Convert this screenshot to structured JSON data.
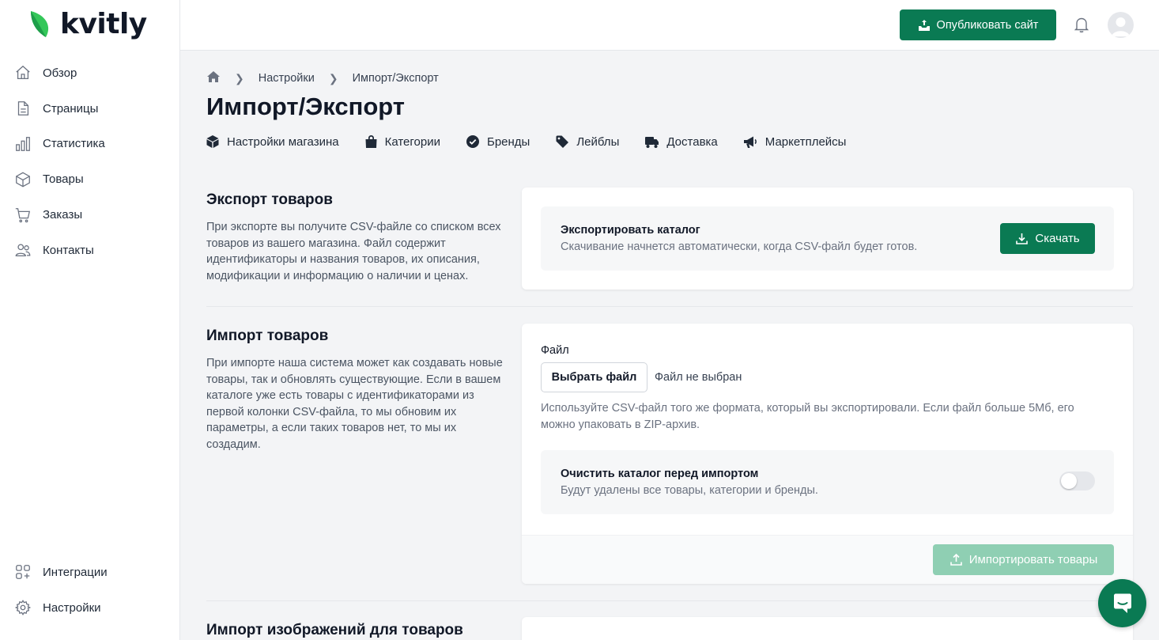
{
  "app": {
    "logo_text": "kvitly",
    "brand_color": "#0a7a53"
  },
  "sidebar": {
    "items": [
      {
        "label": "Обзор",
        "icon": "home-icon"
      },
      {
        "label": "Страницы",
        "icon": "document-icon"
      },
      {
        "label": "Статистика",
        "icon": "bar-chart-icon"
      },
      {
        "label": "Товары",
        "icon": "box-icon"
      },
      {
        "label": "Заказы",
        "icon": "cart-icon"
      },
      {
        "label": "Контакты",
        "icon": "users-icon"
      }
    ],
    "bottom_items": [
      {
        "label": "Интеграции",
        "icon": "integrations-icon"
      },
      {
        "label": "Настройки",
        "icon": "gear-icon"
      }
    ]
  },
  "topbar": {
    "publish_label": "Опубликовать сайт",
    "bell_icon": "bell-icon",
    "avatar_icon": "user-icon"
  },
  "breadcrumb": {
    "home_icon": "home-icon",
    "items": [
      "Настройки",
      "Импорт/Экспорт"
    ]
  },
  "page_title": "Импорт/Экспорт",
  "subnav": [
    {
      "label": "Настройки магазина",
      "icon": "cube-icon"
    },
    {
      "label": "Категории",
      "icon": "shopping-bag-icon"
    },
    {
      "label": "Бренды",
      "icon": "badge-check-icon"
    },
    {
      "label": "Лейблы",
      "icon": "tag-icon"
    },
    {
      "label": "Доставка",
      "icon": "truck-icon"
    },
    {
      "label": "Маркетплейсы",
      "icon": "megaphone-icon"
    }
  ],
  "export_section": {
    "title": "Экспорт товаров",
    "description": "При экспорте вы получите CSV-файле со списком всех товаров из вашего магазина. Файл содержит идентификаторы и названия товаров, их описания, модификации и информацию о наличии и ценах.",
    "card_title": "Экспортировать каталог",
    "card_subtitle": "Скачивание начнется автоматически, когда CSV-файл будет готов.",
    "download_label": "Скачать"
  },
  "import_section": {
    "title": "Импорт товаров",
    "description": "При импорте наша система может как создавать новые товары, так и обновлять существующие. Если в вашем каталоге уже есть товары с идентификаторами из первой колонки CSV-файла, то мы обновим их параметры, а если таких товаров нет, то мы их создадим.",
    "file_label": "Файл",
    "choose_file_label": "Выбрать файл",
    "file_status": "Файл не выбран",
    "file_hint": "Используйте CSV-файл того же формата, который вы экспортировали. Если файл больше 5Мб, его можно упаковать в ZIP-архив.",
    "clear_title": "Очистить каталог перед импортом",
    "clear_subtitle": "Будут удалены все товары, категории и бренды.",
    "clear_enabled": false,
    "import_label": "Импортировать товары",
    "import_disabled": true
  },
  "images_section": {
    "title": "Импорт изображений для товаров"
  },
  "chat": {
    "icon": "chat-icon"
  }
}
